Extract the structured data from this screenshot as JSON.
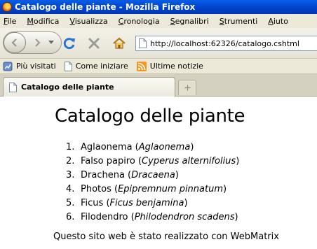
{
  "window": {
    "title": "Catalogo delle piante - Mozilla Firefox"
  },
  "menu": {
    "items": [
      {
        "label": "File",
        "accel": "F",
        "rest": "ile"
      },
      {
        "label": "Modifica",
        "accel": "M",
        "rest": "odifica"
      },
      {
        "label": "Visualizza",
        "accel": "V",
        "rest": "isualizza"
      },
      {
        "label": "Cronologia",
        "accel": "C",
        "rest": "ronologia"
      },
      {
        "label": "Segnalibri",
        "accel": "S",
        "rest": "egnalibri"
      },
      {
        "label": "Strumenti",
        "accel": "S",
        "rest": "trumenti"
      },
      {
        "label": "Aiuto",
        "accel": "A",
        "rest": "iuto"
      }
    ]
  },
  "nav": {
    "url": "http://localhost:62326/catalogo.cshtml",
    "icons": [
      "back-icon",
      "forward-icon",
      "history-dropdown-icon",
      "reload-icon",
      "stop-icon",
      "home-icon",
      "page-icon"
    ]
  },
  "bookmarks": {
    "items": [
      {
        "label": "Più visitati",
        "icon": "most-visited-icon"
      },
      {
        "label": "Come iniziare",
        "icon": "page-icon"
      },
      {
        "label": "Ultime notizie",
        "icon": "rss-icon"
      }
    ]
  },
  "tabs": {
    "active_label": "Catalogo delle piante",
    "new_tab_icon": "new-tab-icon"
  },
  "page": {
    "heading": "Catalogo delle piante",
    "plants": [
      {
        "num": "1.",
        "common": "Aglaonema",
        "latin": "Aglaonema"
      },
      {
        "num": "2.",
        "common": "Falso papiro",
        "latin": "Cyperus alternifolius"
      },
      {
        "num": "3.",
        "common": "Drachena",
        "latin": "Dracaena"
      },
      {
        "num": "4.",
        "common": "Photos",
        "latin": "Epipremnum pinnatum"
      },
      {
        "num": "5.",
        "common": "Ficus",
        "latin": "Ficus benjamina"
      },
      {
        "num": "6.",
        "common": "Filodendro",
        "latin": "Philodendron scadens"
      }
    ],
    "footer": "Questo sito web è stato realizzato con WebMatrix"
  },
  "colors": {
    "titlebar": "#0047d1",
    "chrome": "#ece9d8",
    "reload": "#2a74d6",
    "stop": "#9a9a9a"
  }
}
